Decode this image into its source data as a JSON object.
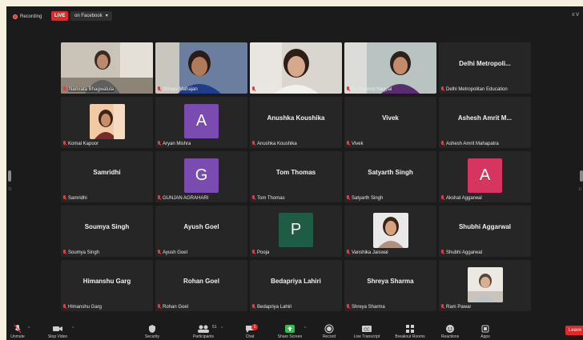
{
  "topbar": {
    "recording_label": "Recording",
    "live_badge": "LIVE",
    "stream_target": "on Facebook",
    "stream_caret": "▾",
    "view_label": "≡ V"
  },
  "side": {
    "left_num": "/3",
    "right_num": "1/"
  },
  "colors": {
    "accent_green": "#b9d870",
    "live_red": "#e02828",
    "share_green": "#2fbf4f"
  },
  "participants": [
    {
      "name": "Namrata Bhagwatula",
      "kind": "video",
      "active": true,
      "photo": "namrata"
    },
    {
      "name": "Shreya Mahajan",
      "kind": "video",
      "photo": "shreya"
    },
    {
      "name": "Riya Kumar",
      "kind": "video",
      "photo": "riya"
    },
    {
      "name": "Dr. Rashmi Nagpal",
      "kind": "video",
      "photo": "rashmi"
    },
    {
      "name": "Delhi Metropolitan Education",
      "kind": "text",
      "title": "Delhi  Metropoli..."
    },
    {
      "name": "Komal Kapoor",
      "kind": "photo",
      "photo": "komal"
    },
    {
      "name": "Aryan Mishra",
      "kind": "avatar",
      "letter": "A",
      "color": "#7a4bb0"
    },
    {
      "name": "Anushka Koushika",
      "kind": "text",
      "title": "Anushka Koushika"
    },
    {
      "name": "Vivek",
      "kind": "text",
      "title": "Vivek"
    },
    {
      "name": "Ashesh Amrit Mahapatra",
      "kind": "text",
      "title": "Ashesh Amrit M..."
    },
    {
      "name": "Samridhi",
      "kind": "text",
      "title": "Samridhi"
    },
    {
      "name": "GUNJAN AGRAHARI",
      "kind": "avatar",
      "letter": "G",
      "color": "#7a4bb0"
    },
    {
      "name": "Tom Thomas",
      "kind": "text",
      "title": "Tom Thomas"
    },
    {
      "name": "Satyarth Singh",
      "kind": "text",
      "title": "Satyarth Singh"
    },
    {
      "name": "Akshat Aggarwal",
      "kind": "avatar",
      "letter": "A",
      "color": "#d6355f"
    },
    {
      "name": "Soumya Singh",
      "kind": "text",
      "title": "Soumya Singh"
    },
    {
      "name": "Ayush Goel",
      "kind": "text",
      "title": "Ayush Goel"
    },
    {
      "name": "Pooja",
      "kind": "avatar",
      "letter": "P",
      "color": "#1f5c46"
    },
    {
      "name": "Vanshika Jaiswal",
      "kind": "photo",
      "photo": "vanshika"
    },
    {
      "name": "Shubhi Aggarwal",
      "kind": "text",
      "title": "Shubhi Aggarwal"
    },
    {
      "name": "Himanshu Garg",
      "kind": "text",
      "title": "Himanshu Garg"
    },
    {
      "name": "Rohan Goel",
      "kind": "text",
      "title": "Rohan Goel"
    },
    {
      "name": "Bedapriya Lahiri",
      "kind": "text",
      "title": "Bedapriya Lahiri"
    },
    {
      "name": "Shreya Sharma",
      "kind": "text",
      "title": "Shreya Sharma"
    },
    {
      "name": "Ram Pawar",
      "kind": "photo",
      "photo": "ram"
    }
  ],
  "toolbar": {
    "unmute": "Unmute",
    "stop_video": "Stop Video",
    "security": "Security",
    "participants": "Participants",
    "participants_count": "51",
    "chat": "Chat",
    "chat_badge": "1",
    "share_screen": "Share Screen",
    "record": "Record",
    "live_transcript": "Live Transcript",
    "breakout_rooms": "Breakout Rooms",
    "reactions": "Reactions",
    "apps": "Apps",
    "leave": "Leave"
  }
}
